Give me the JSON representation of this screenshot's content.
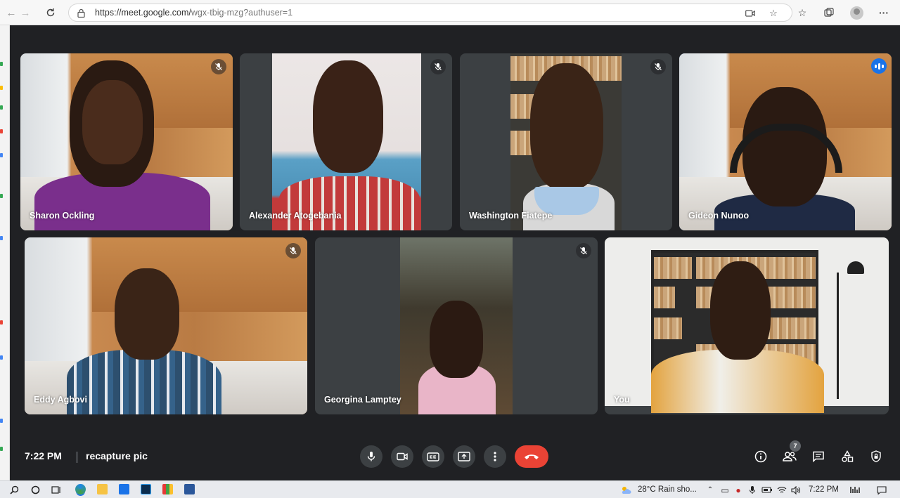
{
  "browser": {
    "url": "https://meet.google.com/",
    "url_dim": "wgx-tbig-mzg?authuser=1"
  },
  "participants": [
    {
      "name": "Sharon Ockling",
      "muted": true
    },
    {
      "name": "Alexander Atogebania",
      "muted": true
    },
    {
      "name": "Washington Fiatepe",
      "muted": true
    },
    {
      "name": "Gideon Nunoo",
      "muted": false,
      "speaking": true
    },
    {
      "name": "Eddy Agbovi",
      "muted": true
    },
    {
      "name": "Georgina Lamptey",
      "muted": true
    },
    {
      "name": "You",
      "muted": false
    }
  ],
  "meeting": {
    "time": "7:22 PM",
    "title": "recapture pic",
    "participant_count": "7"
  },
  "colors": {
    "stage_bg": "#202124",
    "hangup": "#ea4335",
    "speaking_outline": "#8ab4f8",
    "speaking_indicator": "#1a73e8"
  },
  "taskbar": {
    "weather": "28°C  Rain sho...",
    "clock": "7:22 PM"
  }
}
